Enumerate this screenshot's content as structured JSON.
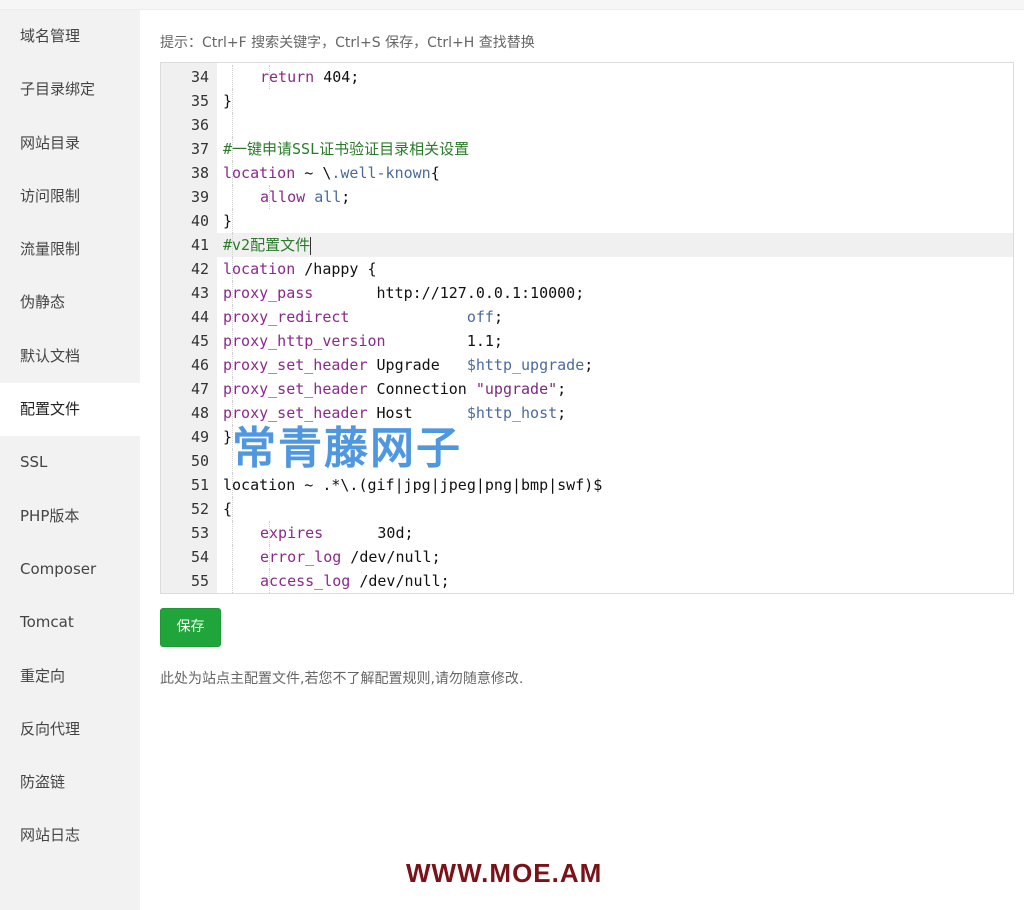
{
  "sidebar": {
    "items": [
      {
        "label": "域名管理"
      },
      {
        "label": "子目录绑定"
      },
      {
        "label": "网站目录"
      },
      {
        "label": "访问限制"
      },
      {
        "label": "流量限制"
      },
      {
        "label": "伪静态"
      },
      {
        "label": "默认文档"
      },
      {
        "label": "配置文件",
        "active": true
      },
      {
        "label": "SSL"
      },
      {
        "label": "PHP版本"
      },
      {
        "label": "Composer"
      },
      {
        "label": "Tomcat"
      },
      {
        "label": "重定向"
      },
      {
        "label": "反向代理"
      },
      {
        "label": "防盗链"
      },
      {
        "label": "网站日志"
      }
    ]
  },
  "main": {
    "hint": "提示：Ctrl+F 搜索关键字，Ctrl+S 保存，Ctrl+H 查找替换",
    "save_label": "保存",
    "note": "此处为站点主配置文件,若您不了解配置规则,请勿随意修改."
  },
  "editor": {
    "current_line": 41,
    "lines": [
      {
        "n": "34",
        "indent": 2,
        "parts": [
          [
            "kw",
            "return"
          ],
          [
            "",
            " 404;"
          ]
        ]
      },
      {
        "n": "35",
        "indent": 1,
        "parts": [
          [
            "",
            "}"
          ]
        ]
      },
      {
        "n": "36",
        "indent": 1,
        "parts": []
      },
      {
        "n": "37",
        "indent": 1,
        "parts": [
          [
            "cm",
            "#一键申请SSL证书验证目录相关设置"
          ]
        ]
      },
      {
        "n": "38",
        "indent": 1,
        "parts": [
          [
            "kw",
            "location"
          ],
          [
            "",
            " ~ \\"
          ],
          [
            "vr",
            ".well-known"
          ],
          [
            "",
            "{"
          ]
        ]
      },
      {
        "n": "39",
        "indent": 2,
        "parts": [
          [
            "kw",
            "allow"
          ],
          [
            "",
            " "
          ],
          [
            "vr",
            "all"
          ],
          [
            "",
            ";"
          ]
        ]
      },
      {
        "n": "40",
        "indent": 1,
        "parts": [
          [
            "",
            "}"
          ]
        ]
      },
      {
        "n": "41",
        "indent": 1,
        "parts": [
          [
            "cm",
            "#v2配置文件"
          ]
        ],
        "cursor": true
      },
      {
        "n": "42",
        "indent": 1,
        "parts": [
          [
            "kw",
            "location"
          ],
          [
            "",
            " /happy {"
          ]
        ]
      },
      {
        "n": "43",
        "indent": 1,
        "parts": [
          [
            "kw",
            "proxy_pass"
          ],
          [
            "",
            "       http://127.0.0.1:10000;"
          ]
        ]
      },
      {
        "n": "44",
        "indent": 1,
        "parts": [
          [
            "kw",
            "proxy_redirect"
          ],
          [
            "",
            "             "
          ],
          [
            "vr",
            "off"
          ],
          [
            "",
            ";"
          ]
        ]
      },
      {
        "n": "45",
        "indent": 1,
        "parts": [
          [
            "kw",
            "proxy_http_version"
          ],
          [
            "",
            "         1.1;"
          ]
        ]
      },
      {
        "n": "46",
        "indent": 1,
        "parts": [
          [
            "kw",
            "proxy_set_header"
          ],
          [
            "",
            " Upgrade   "
          ],
          [
            "vr",
            "$http_upgrade"
          ],
          [
            "",
            ";"
          ]
        ]
      },
      {
        "n": "47",
        "indent": 1,
        "parts": [
          [
            "kw",
            "proxy_set_header"
          ],
          [
            "",
            " Connection "
          ],
          [
            "str",
            "\"upgrade\""
          ],
          [
            "",
            ";"
          ]
        ]
      },
      {
        "n": "48",
        "indent": 1,
        "parts": [
          [
            "kw",
            "proxy_set_header"
          ],
          [
            "",
            " Host      "
          ],
          [
            "vr",
            "$http_host"
          ],
          [
            "",
            ";"
          ]
        ]
      },
      {
        "n": "49",
        "indent": 1,
        "parts": [
          [
            "",
            "}"
          ]
        ]
      },
      {
        "n": "50",
        "indent": 1,
        "parts": []
      },
      {
        "n": "51",
        "indent": 1,
        "parts": [
          [
            "",
            "location ~ .*\\.(gif|jpg|jpeg|png|bmp|swf)$"
          ]
        ]
      },
      {
        "n": "52",
        "indent": 1,
        "parts": [
          [
            "",
            "{"
          ]
        ]
      },
      {
        "n": "53",
        "indent": 2,
        "parts": [
          [
            "kw",
            "expires"
          ],
          [
            "",
            "      30d;"
          ]
        ]
      },
      {
        "n": "54",
        "indent": 2,
        "parts": [
          [
            "kw",
            "error_log"
          ],
          [
            "",
            " /dev/null;"
          ]
        ]
      },
      {
        "n": "55",
        "indent": 2,
        "parts": [
          [
            "kw",
            "access_log"
          ],
          [
            "",
            " /dev/null;"
          ]
        ]
      }
    ]
  },
  "watermark": "常青藤网子",
  "site_url": "WWW.MOE.AM"
}
